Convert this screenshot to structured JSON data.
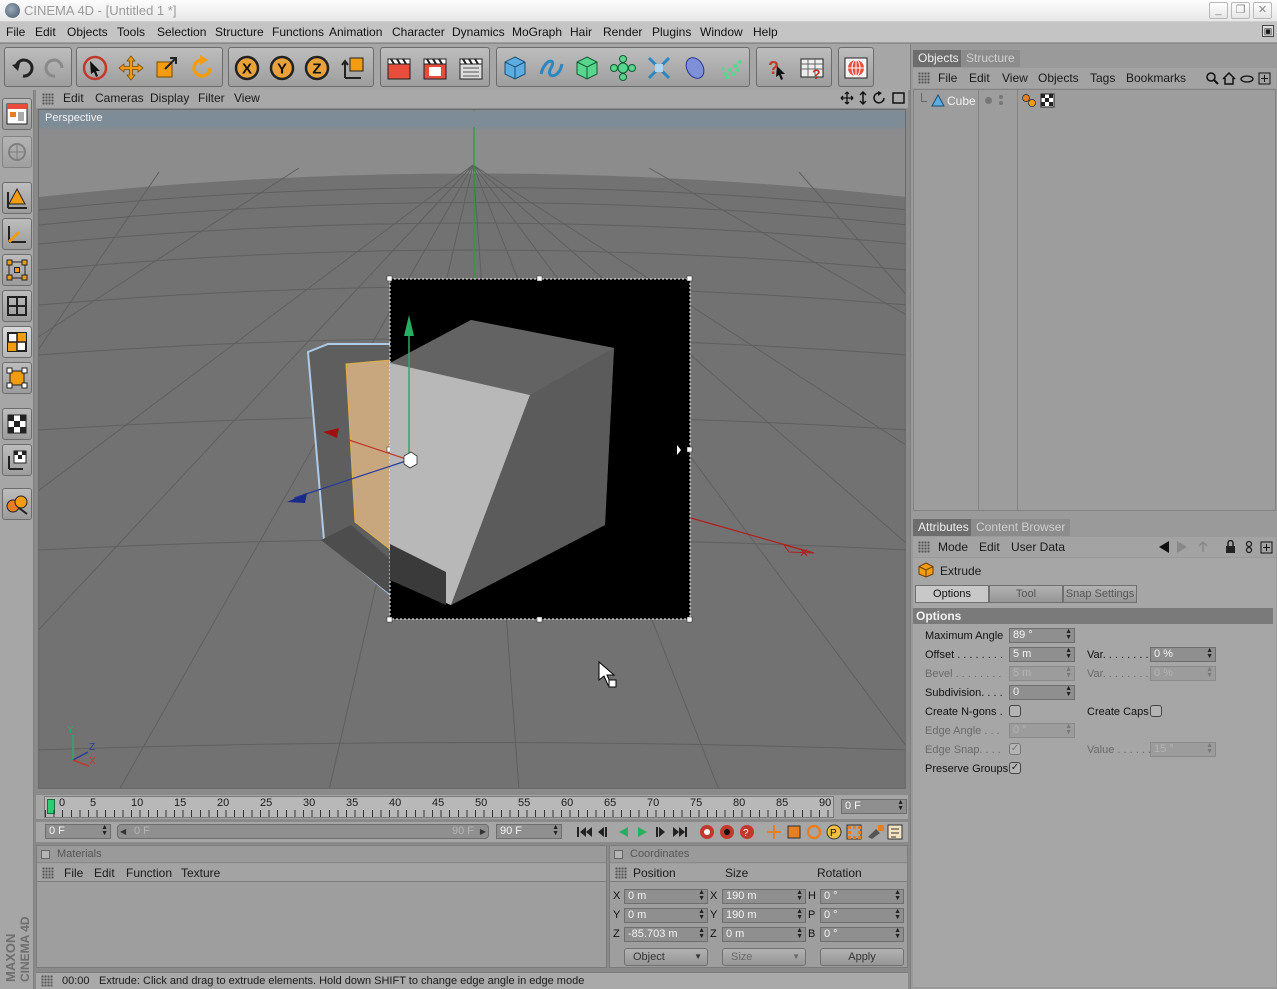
{
  "window": {
    "title": "CINEMA 4D - [Untitled 1 *]",
    "buttons": [
      "_",
      "❐",
      "✕"
    ]
  },
  "menubar": [
    "File",
    "Edit",
    "Objects",
    "Tools",
    "Selection",
    "Structure",
    "Functions",
    "Animation",
    "Character",
    "Dynamics",
    "MoGraph",
    "Hair",
    "Render",
    "Plugins",
    "Window",
    "Help"
  ],
  "viewport": {
    "menu": [
      "Edit",
      "Cameras",
      "Display",
      "Filter",
      "View"
    ],
    "label": "Perspective",
    "axis_labels": {
      "y": "Y",
      "z": "Z",
      "x": "X"
    }
  },
  "timeline": {
    "ticks": [
      "0",
      "5",
      "10",
      "15",
      "20",
      "25",
      "30",
      "35",
      "40",
      "45",
      "50",
      "55",
      "60",
      "65",
      "70",
      "75",
      "80",
      "85",
      "90"
    ],
    "current_frame": "0 F",
    "start_field": "0 F",
    "range_start": "0 F",
    "range_end": "90 F",
    "end_field": "90 F"
  },
  "materials": {
    "title": "Materials",
    "menu": [
      "File",
      "Edit",
      "Function",
      "Texture"
    ]
  },
  "coordinates": {
    "title": "Coordinates",
    "headers": [
      "Position",
      "Size",
      "Rotation"
    ],
    "rows": [
      {
        "axis": "X",
        "pos": "0 m",
        "size_axis": "X",
        "size": "190 m",
        "rot_axis": "H",
        "rot": "0 °"
      },
      {
        "axis": "Y",
        "pos": "0 m",
        "size_axis": "Y",
        "size": "190 m",
        "rot_axis": "P",
        "rot": "0 °"
      },
      {
        "axis": "Z",
        "pos": "-85.703 m",
        "size_axis": "Z",
        "size": "0 m",
        "rot_axis": "B",
        "rot": "0 °"
      }
    ],
    "mode": "Object",
    "size_mode": "Size",
    "apply": "Apply"
  },
  "status": {
    "time": "00:00",
    "message": "Extrude: Click and drag to extrude elements. Hold down SHIFT to change edge angle in edge mode"
  },
  "objects_panel": {
    "tabs": [
      "Objects",
      "Structure"
    ],
    "menu": [
      "File",
      "Edit",
      "View",
      "Objects",
      "Tags",
      "Bookmarks"
    ],
    "object_name": "Cube"
  },
  "attributes_panel": {
    "tabs": [
      "Attributes",
      "Content Browser"
    ],
    "menu": [
      "Mode",
      "Edit",
      "User Data"
    ],
    "tool_name": "Extrude",
    "subtabs": [
      "Options",
      "Tool",
      "Snap Settings"
    ],
    "section": "Options",
    "fields": {
      "max_angle_label": "Maximum Angle",
      "max_angle": "89 °",
      "offset_label": "Offset . . . . . . . .",
      "offset": "5 m",
      "var1_label": "Var. . . . . . . .",
      "var1": "0 %",
      "bevel_label": "Bevel . . . . . . . .",
      "bevel": "5 m",
      "var2_label": "Var. . . . . . . .",
      "var2": "0 %",
      "subdiv_label": "Subdivision. . . .",
      "subdiv": "0",
      "ngons_label": "Create N-gons .",
      "caps_label": "Create Caps",
      "edge_angle_label": "Edge Angle . . .",
      "edge_angle": "0 °",
      "edge_snap_label": "Edge Snap. . . .",
      "value_label": "Value . . . . . .",
      "value": "15 °",
      "preserve_label": "Preserve Groups"
    }
  },
  "branding": "MAXON CINEMA 4D"
}
